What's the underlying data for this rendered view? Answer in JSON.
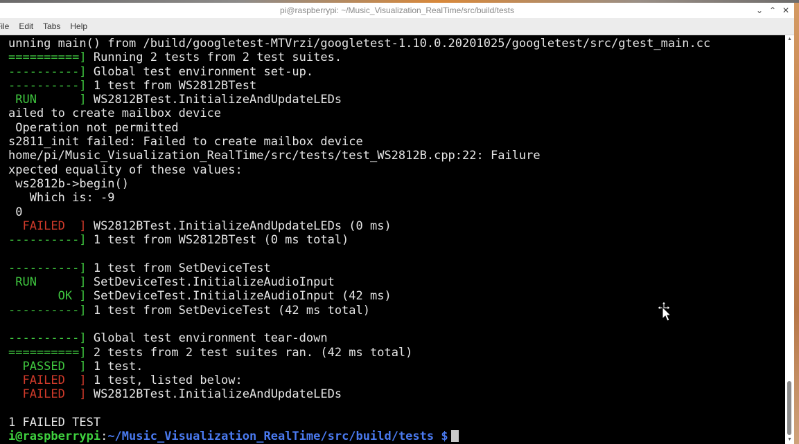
{
  "window": {
    "title": "pi@raspberrypi: ~/Music_Visualization_RealTime/src/build/tests",
    "controls": {
      "minimize": "⌄",
      "maximize": "⌃",
      "close": "✕"
    }
  },
  "menu": {
    "items": [
      "File",
      "Edit",
      "Tabs",
      "Help"
    ]
  },
  "terminal": {
    "lines": [
      [
        {
          "t": "unning main() from /build/googletest-MTVrzi/googletest-1.10.0.20201025/googletest/src/gtest_main.cc",
          "c": "w"
        }
      ],
      [
        {
          "t": "==========]",
          "c": "g"
        },
        {
          "t": " Running 2 tests from 2 test suites.",
          "c": "w"
        }
      ],
      [
        {
          "t": "----------]",
          "c": "g"
        },
        {
          "t": " Global test environment set-up.",
          "c": "w"
        }
      ],
      [
        {
          "t": "----------]",
          "c": "g"
        },
        {
          "t": " 1 test from WS2812BTest",
          "c": "w"
        }
      ],
      [
        {
          "t": " RUN      ]",
          "c": "g"
        },
        {
          "t": " WS2812BTest.InitializeAndUpdateLEDs",
          "c": "w"
        }
      ],
      [
        {
          "t": "ailed to create mailbox device",
          "c": "w"
        }
      ],
      [
        {
          "t": " Operation not permitted",
          "c": "w"
        }
      ],
      [
        {
          "t": "s2811_init failed: Failed to create mailbox device",
          "c": "w"
        }
      ],
      [
        {
          "t": "home/pi/Music_Visualization_RealTime/src/tests/test_WS2812B.cpp:22: Failure",
          "c": "w"
        }
      ],
      [
        {
          "t": "xpected equality of these values:",
          "c": "w"
        }
      ],
      [
        {
          "t": " ws2812b->begin()",
          "c": "w"
        }
      ],
      [
        {
          "t": "   Which is: -9",
          "c": "w"
        }
      ],
      [
        {
          "t": " 0",
          "c": "w"
        }
      ],
      [
        {
          "t": "  FAILED  ]",
          "c": "r"
        },
        {
          "t": " WS2812BTest.InitializeAndUpdateLEDs (0 ms)",
          "c": "w"
        }
      ],
      [
        {
          "t": "----------]",
          "c": "g"
        },
        {
          "t": " 1 test from WS2812BTest (0 ms total)",
          "c": "w"
        }
      ],
      [],
      [
        {
          "t": "----------]",
          "c": "g"
        },
        {
          "t": " 1 test from SetDeviceTest",
          "c": "w"
        }
      ],
      [
        {
          "t": " RUN      ]",
          "c": "g"
        },
        {
          "t": " SetDeviceTest.InitializeAudioInput",
          "c": "w"
        }
      ],
      [
        {
          "t": "       OK ]",
          "c": "g"
        },
        {
          "t": " SetDeviceTest.InitializeAudioInput (42 ms)",
          "c": "w"
        }
      ],
      [
        {
          "t": "----------]",
          "c": "g"
        },
        {
          "t": " 1 test from SetDeviceTest (42 ms total)",
          "c": "w"
        }
      ],
      [],
      [
        {
          "t": "----------]",
          "c": "g"
        },
        {
          "t": " Global test environment tear-down",
          "c": "w"
        }
      ],
      [
        {
          "t": "==========]",
          "c": "g"
        },
        {
          "t": " 2 tests from 2 test suites ran. (42 ms total)",
          "c": "w"
        }
      ],
      [
        {
          "t": "  PASSED  ]",
          "c": "g"
        },
        {
          "t": " 1 test.",
          "c": "w"
        }
      ],
      [
        {
          "t": "  FAILED  ]",
          "c": "r"
        },
        {
          "t": " 1 test, listed below:",
          "c": "w"
        }
      ],
      [
        {
          "t": "  FAILED  ]",
          "c": "r"
        },
        {
          "t": " WS2812BTest.InitializeAndUpdateLEDs",
          "c": "w"
        }
      ],
      [],
      [
        {
          "t": "1 FAILED TEST",
          "c": "w"
        }
      ],
      [
        {
          "t": "i@raspberrypi",
          "c": "pg"
        },
        {
          "t": ":",
          "c": "w"
        },
        {
          "t": "~/Music_Visualization_RealTime/src/build/tests $",
          "c": "pb"
        }
      ]
    ]
  },
  "colors": {
    "pass_green": "#3fc63f",
    "fail_red": "#d03a2a",
    "prompt_blue": "#4a7af0",
    "background": "#000000"
  }
}
